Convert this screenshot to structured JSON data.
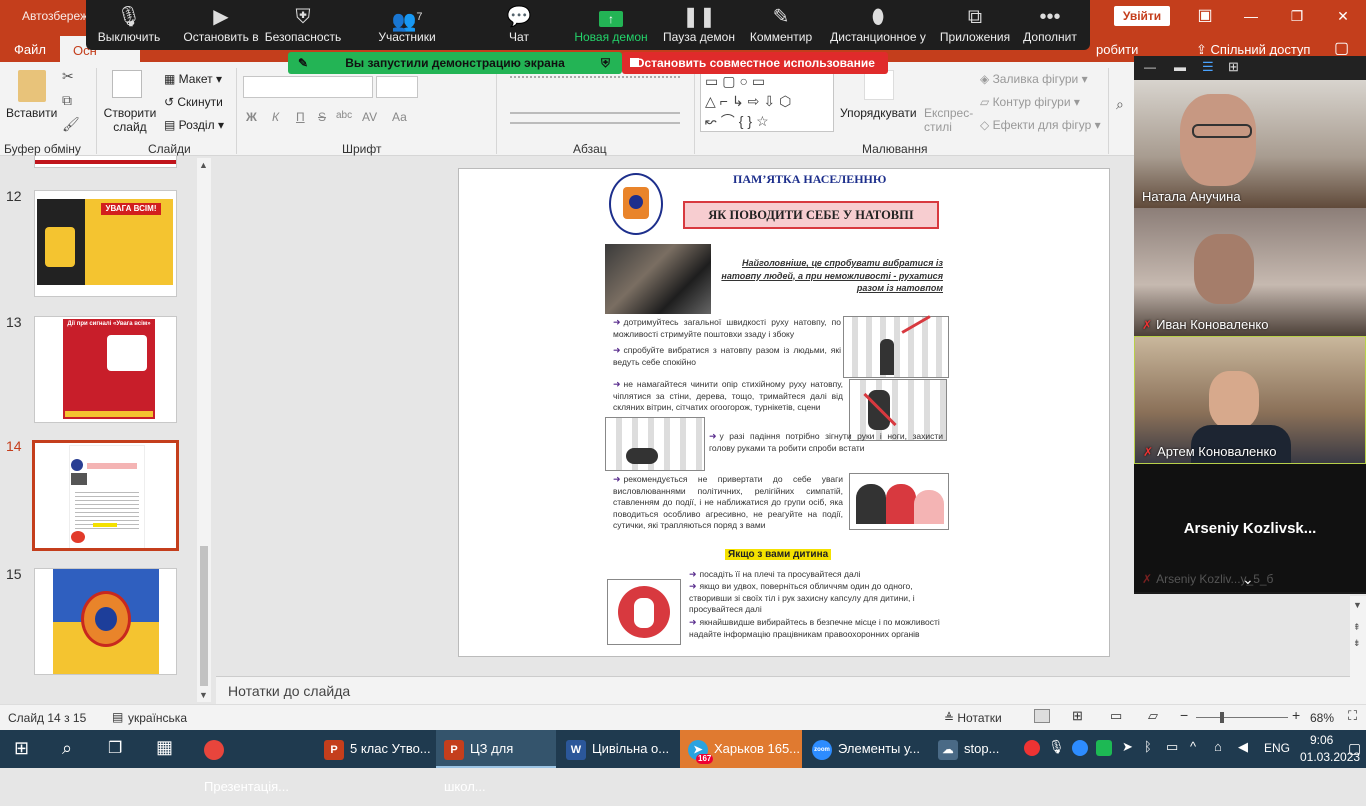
{
  "app_title": "Автозбереж",
  "titlebar": {
    "signin": "Увійти",
    "minimize": "—",
    "restore": "❐",
    "close": "✕"
  },
  "tabs": {
    "file": "Файл",
    "home": "Осн",
    "share": "Спільний доступ",
    "tell_me": "робити"
  },
  "zoom_toolbar": {
    "mute": "Выключить",
    "stop_video": "Остановить в",
    "security": "Безопасность",
    "participants": "Участники",
    "participants_count": "7",
    "chat": "Чат",
    "new_share": "Новая демон",
    "pause_share": "Пауза демон",
    "annotate": "Комментир",
    "remote": "Дистанционное у",
    "apps": "Приложения",
    "more": "Дополнит"
  },
  "share_banner": {
    "text": "Вы запустили демонстрацию экрана",
    "stop": "Остановить совместное использование"
  },
  "ribbon": {
    "paste": "Вставити",
    "clipboard": "Буфер обміну",
    "new_slide": "Створити слайд",
    "layout": "Макет",
    "reset": "Скинути",
    "section": "Розділ",
    "slides": "Слайди",
    "font": "Шрифт",
    "font_bold": "Ж",
    "font_italic": "К",
    "font_underline": "П",
    "font_strike": "S",
    "font_shadow": "abc",
    "font_spacing": "AV",
    "font_case": "Аа",
    "paragraph": "Абзац",
    "arrange": "Упорядкувати",
    "quick_styles": "Експрес-стилі",
    "fill": "Заливка фігури",
    "outline": "Контур фігури",
    "effects": "Ефекти для фігур",
    "drawing": "Малювання"
  },
  "thumbnails": [
    {
      "num": "12",
      "caption": "УВАГА ВСІМ!"
    },
    {
      "num": "13",
      "caption": "Дії при сигналі «Увага всім»"
    },
    {
      "num": "14",
      "caption": ""
    },
    {
      "num": "15",
      "caption": ""
    }
  ],
  "slide": {
    "header": "ПАМ’ЯТКА  НАСЕЛЕННЮ",
    "title": "ЯК  ПОВОДИТИ  СЕБЕ  У  НАТОВПІ",
    "lead": "Найголовніше, це спробувати вибратися із натовпу людей, а при неможливості - рухатися разом із натовпом",
    "bullets": [
      "дотримуйтесь загальної швидкості руху натовпу, по можливості стримуйте поштовхи ззаду і збоку",
      "спробуйте вибратися з натовпу разом із людьми, які ведуть себе спокійно",
      "не намагайтеся чинити опір стихійному руху натовпу, чіплятися за стіни, дерева, тощо, тримайтеся далі від скляних вітрин, сітчатих огоогорож, турнікетів, сцени",
      "у разі падіння потрібно зігнути руки і ноги, захисти голову руками та робити спроби встати",
      "рекомендується не привертати до себе уваги висловлюваннями політичних, релігійних симпатій, ставленням до події, і не наближатися до групи осіб, яка поводиться особливо агресивно, не реагуйте на події, сутички, які трапляються поряд з вами"
    ],
    "child_heading": "Якщо з вами дитина",
    "child_bullets": [
      "посадіть її на плечі та просувайтеся далі",
      "якщо ви удвох, поверніться обличчям один до одного, створивши зі своїх тіл і рук захисну капсулу для дитини, і просувайтеся далі",
      "якнайшвидше вибирайтесь в безпечне місце і по можливості надайте інформацію працівникам правоохоронних органів"
    ]
  },
  "notes": "Нотатки до слайда",
  "status": {
    "slide": "Слайд 14 з 15",
    "language": "українська",
    "notes": "Нотатки",
    "zoom": "68%"
  },
  "video": {
    "participants": [
      {
        "name": "Натала Анучина",
        "muted": false
      },
      {
        "name": "Иван Коноваленко",
        "muted": true
      },
      {
        "name": "Артем Коноваленко",
        "muted": true
      }
    ],
    "big_name": "Arseniy  Kozlivsk...",
    "small_name": "Arseniy Kozliv...y_5_б"
  },
  "taskbar": {
    "apps": [
      {
        "label": "Презентація...",
        "icon": "chrome-icon"
      },
      {
        "label": "5 клас Утво...",
        "icon": "powerpoint-icon"
      },
      {
        "label": "ЦЗ для школ...",
        "icon": "powerpoint-icon"
      },
      {
        "label": "Цивільна о...",
        "icon": "word-icon"
      },
      {
        "label": "Харьков 165...",
        "icon": "telegram-icon",
        "badge": "167"
      },
      {
        "label": "Элементы у...",
        "icon": "zoom-icon"
      },
      {
        "label": "stop...",
        "icon": "weather-icon"
      }
    ],
    "lang": "ENG",
    "time": "9:06",
    "date": "01.03.2023"
  }
}
